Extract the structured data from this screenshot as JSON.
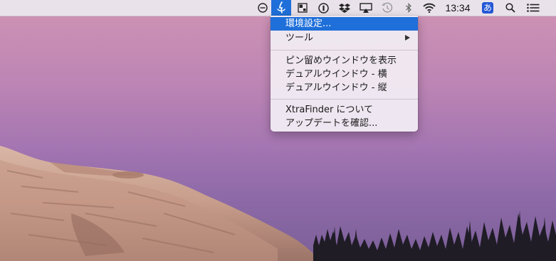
{
  "menubar": {
    "clock": "13:34",
    "input_method": "あ",
    "icons": [
      "do-not-disturb-icon",
      "xtrafinder-icon",
      "screen-layout-icon",
      "password-manager-icon",
      "dropbox-icon",
      "airplay-icon",
      "time-machine-icon",
      "bluetooth-icon",
      "wifi-icon",
      "input-method-icon",
      "spotlight-search-icon",
      "notification-center-icon"
    ],
    "accent_color": "#1e6fd9"
  },
  "menu": {
    "items": [
      {
        "label": "環境設定..."
      },
      {
        "label": "ツール"
      },
      {
        "label": "ピン留めウインドウを表示"
      },
      {
        "label": "デュアルウインドウ - 横"
      },
      {
        "label": "デュアルウインドウ - 縦"
      },
      {
        "label": "XtraFinder について"
      },
      {
        "label": "アップデートを確認..."
      }
    ]
  }
}
